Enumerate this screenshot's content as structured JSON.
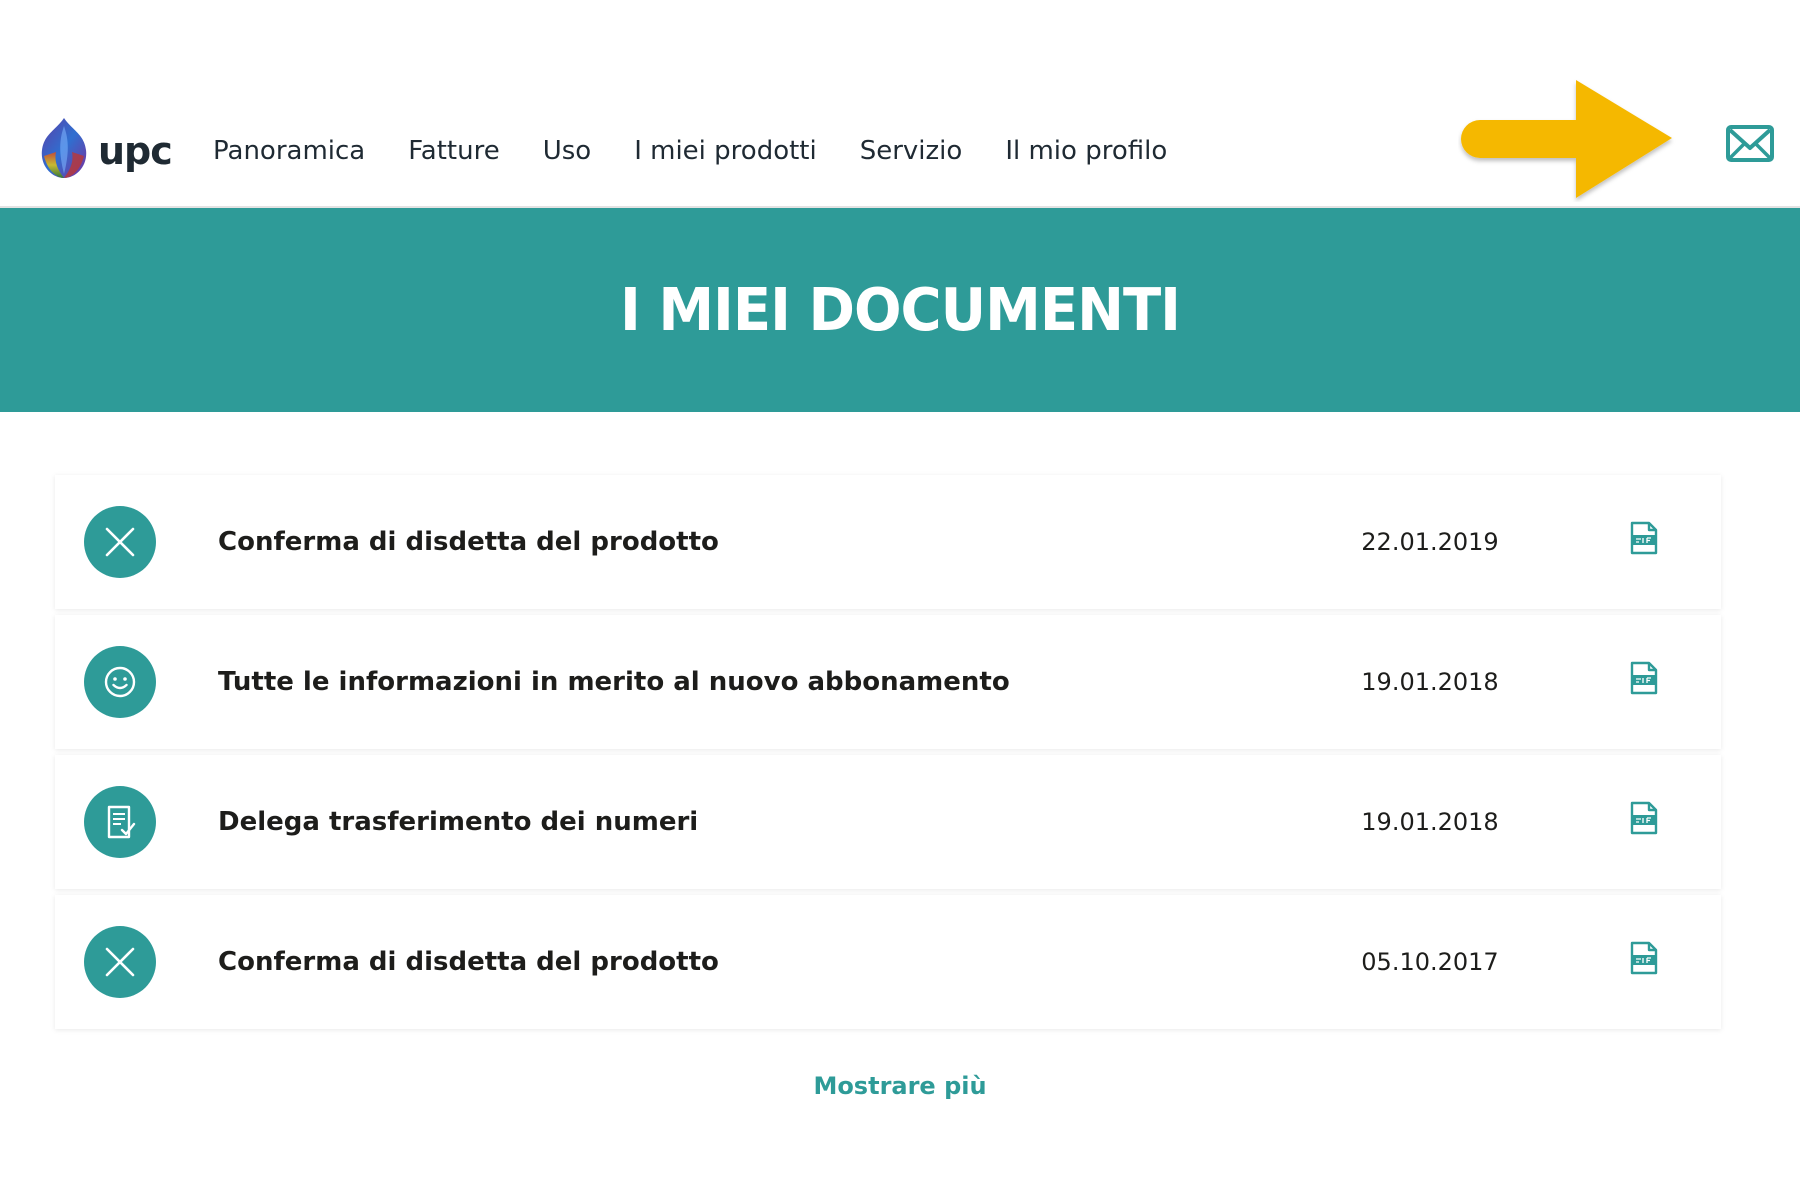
{
  "brand": {
    "name": "upc",
    "accent_color": "#2e9b98"
  },
  "nav": {
    "items": [
      {
        "label": "Panoramica"
      },
      {
        "label": "Fatture"
      },
      {
        "label": "Uso"
      },
      {
        "label": "I miei prodotti"
      },
      {
        "label": "Servizio"
      },
      {
        "label": "Il mio profilo"
      }
    ]
  },
  "header": {
    "mail_icon": "envelope-icon",
    "annotation": "arrow-pointing-to-mail"
  },
  "banner": {
    "title": "I MIEI DOCUMENTI"
  },
  "documents": [
    {
      "icon": "close-icon",
      "title": "Conferma di disdetta del prodotto",
      "date": "22.01.2019",
      "file_icon": "pdf-icon"
    },
    {
      "icon": "smiley-icon",
      "title": "Tutte le informazioni in merito al nuovo abbonamento",
      "date": "19.01.2018",
      "file_icon": "pdf-icon"
    },
    {
      "icon": "document-check-icon",
      "title": "Delega trasferimento dei numeri",
      "date": "19.01.2018",
      "file_icon": "pdf-icon"
    },
    {
      "icon": "close-icon",
      "title": "Conferma di disdetta del prodotto",
      "date": "05.10.2017",
      "file_icon": "pdf-icon"
    }
  ],
  "show_more": {
    "label": "Mostrare più"
  }
}
